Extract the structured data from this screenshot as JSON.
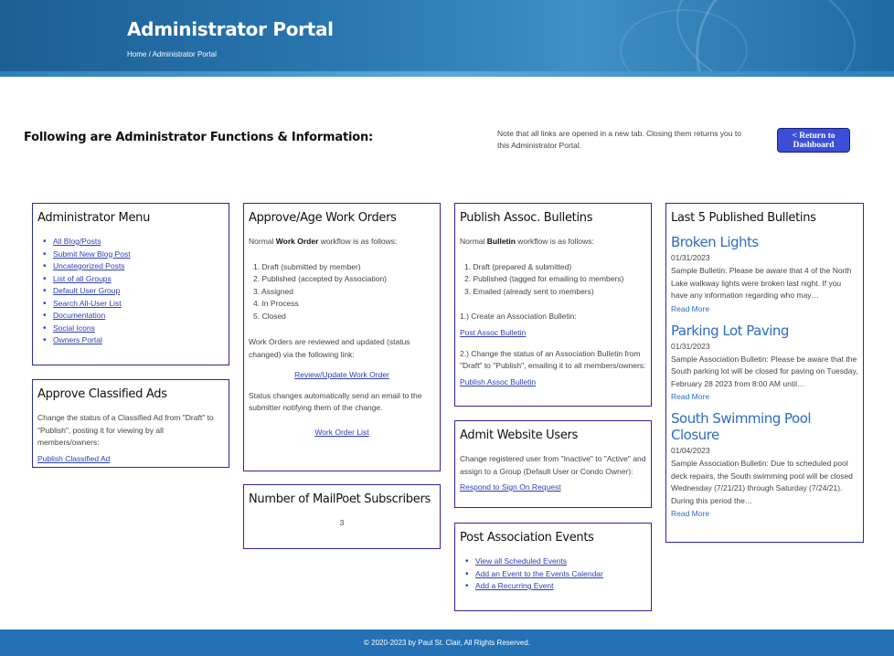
{
  "header": {
    "title": "Administrator Portal",
    "breadcrumb_home": "Home",
    "breadcrumb_sep": "/",
    "breadcrumb_current": "Administrator Portal"
  },
  "intro": {
    "heading": "Following are Administrator Functions & Information:",
    "note": "Note that all links are opened in a new tab. Closing them returns you to this Administrator Portal.",
    "return_button_line1": "< Return to",
    "return_button_line2": "Dashboard"
  },
  "admin_menu": {
    "title": "Administrator Menu",
    "links": [
      "All Blog/Posts",
      "Submit New Blog Post",
      "Uncategorized Posts",
      "List of all Groups",
      "Default User Group",
      "Search All-User List",
      "Documentation",
      "Social Icons",
      "Owners Portal"
    ]
  },
  "classified": {
    "title": "Approve Classified Ads",
    "text": "Change the status of a Classified Ad from \"Draft\" to \"Publish\", posting it for viewing by all members/owners:",
    "link": "Publish Classified Ad"
  },
  "work_orders": {
    "title": "Approve/Age Work Orders",
    "intro_pre": "Normal ",
    "intro_bold": "Work Order",
    "intro_post": " workflow is as follows:",
    "steps": [
      "1. Draft (submitted by member)",
      "2. Published (accepted by Association)",
      "3. Assigned",
      "4. In Process",
      "5. Closed"
    ],
    "review_text": "Work Orders are reviewed and updated (status changed) via the following link:",
    "review_link": "Review/Update Work Order",
    "email_text": "Status changes automatically send an email to the submitter notifying them of the change.",
    "list_link": "Work Order List"
  },
  "mailpoet": {
    "title": "Number of MailPoet Subscribers",
    "count": "3"
  },
  "bulletins": {
    "title": "Publish Assoc. Bulletins",
    "intro_pre": "Normal ",
    "intro_bold": "Bulletin",
    "intro_post": " workflow is as follows:",
    "steps": [
      "1. Draft (prepared & submitted)",
      "2. Published (tagged for emailing to members)",
      "3. Emailed (already sent to members)"
    ],
    "create_text": "1.) Create an Association Bulletin:",
    "create_link": "Post Assoc Bulletin",
    "change_text": "2.) Change the status of an Association Bulletin from \"Draft\" to \"Publish\", emailing it to all members/owners:",
    "change_link": "Publish Assoc Bulletin"
  },
  "website_users": {
    "title": "Admit Website Users",
    "text": "Change registered user from \"Inactive\" to \"Active\" and assign to a Group (Default User or Condo Owner):",
    "link": "Respond to Sign On Request"
  },
  "events": {
    "title": "Post Association Events",
    "links": [
      "View all Scheduled Events",
      "Add an Event to the Events Calendar",
      "Add a Recurring Event"
    ]
  },
  "last_bulletins": {
    "title": "Last 5 Published Bulletins",
    "items": [
      {
        "title": "Broken Lights",
        "date": "01/31/2023",
        "excerpt": "Sample Bulletin: Please be aware that 4 of the North Lake walkway lights were broken last night.  If you have any information regarding who may…",
        "read_more": "Read More"
      },
      {
        "title": "Parking Lot Paving",
        "date": "01/31/2023",
        "excerpt": "Sample Association Bulletin: Please be aware that the South parking lot will be closed for paving on Tuesday, February 28 2023 from 8:00 AM until…",
        "read_more": "Read More"
      },
      {
        "title": "South Swimming Pool Closure",
        "date": "01/04/2023",
        "excerpt": "Sample Association Bulletin: Due to scheduled pool deck repairs, the South swimming pool will be closed Wednesday (7/21/21) through Saturday (7/24/21). During this period the…",
        "read_more": "Read More"
      }
    ]
  },
  "footer": {
    "text": "© 2020-2023 by Paul St. Clair, All Rights Reserved."
  }
}
